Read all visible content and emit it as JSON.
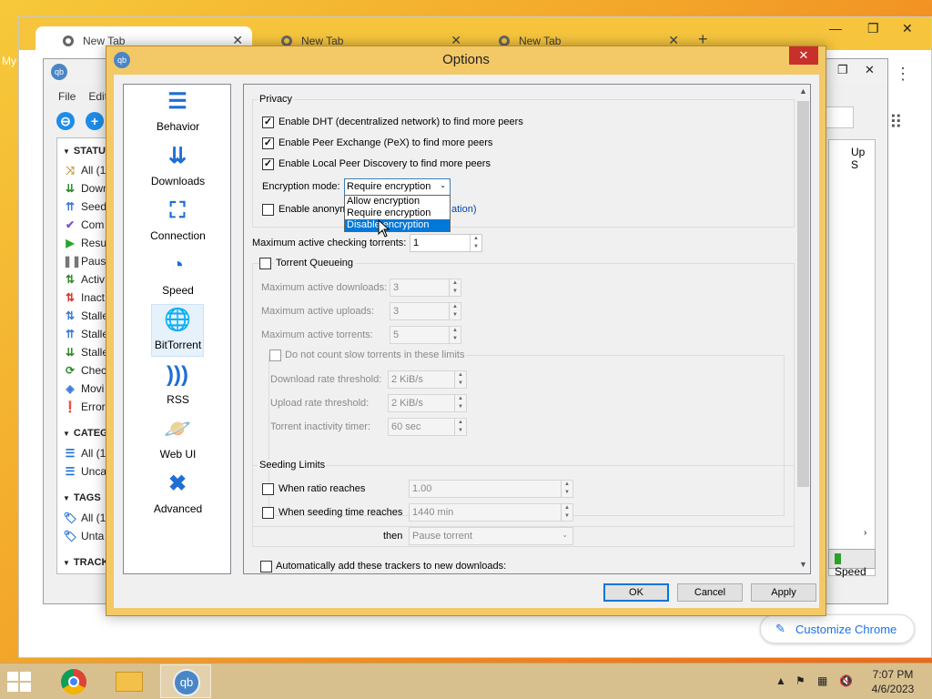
{
  "desktop": {
    "icon_label": "My"
  },
  "chrome": {
    "tabs": [
      {
        "title": "New Tab"
      },
      {
        "title": "New Tab"
      },
      {
        "title": "New Tab"
      }
    ],
    "customize_label": "Customize Chrome"
  },
  "qbt": {
    "menu": [
      "File",
      "Edit"
    ],
    "status_header": "STATUS",
    "status_items": [
      {
        "label": "All (1",
        "icon": "shuffle-icon",
        "color": "#c79a35"
      },
      {
        "label": "Down",
        "icon": "download-icon",
        "color": "#2e8b2e"
      },
      {
        "label": "Seed",
        "icon": "seed-icon",
        "color": "#3a7bd5"
      },
      {
        "label": "Com",
        "icon": "check-icon",
        "color": "#7b4fd0"
      },
      {
        "label": "Resu",
        "icon": "play-icon",
        "color": "#2aa52a"
      },
      {
        "label": "Paus",
        "icon": "pause-icon",
        "color": "#777777"
      },
      {
        "label": "Activ",
        "icon": "active-icon",
        "color": "#2e8b2e"
      },
      {
        "label": "Inact",
        "icon": "inactive-icon",
        "color": "#d9342b"
      },
      {
        "label": "Stalle",
        "icon": "stalled-icon",
        "color": "#3a7bd5"
      },
      {
        "label": "Stalle",
        "icon": "stalled-up-icon",
        "color": "#3a7bd5"
      },
      {
        "label": "Stalle",
        "icon": "stalled-down-icon",
        "color": "#2e8b2e"
      },
      {
        "label": "Chec",
        "icon": "refresh-icon",
        "color": "#2e8b2e"
      },
      {
        "label": "Movi",
        "icon": "moving-icon",
        "color": "#3a7bd5"
      },
      {
        "label": "Error",
        "icon": "error-icon",
        "color": "#d9342b"
      }
    ],
    "categories_header": "CATEG",
    "category_items": [
      {
        "label": "All (1",
        "icon": "list-icon"
      },
      {
        "label": "Unca",
        "icon": "list-icon"
      }
    ],
    "tags_header": "TAGS",
    "tag_items": [
      {
        "label": "All (1",
        "icon": "tag-icon"
      },
      {
        "label": "Unta",
        "icon": "tag-icon"
      }
    ],
    "trackers_header": "TRACK",
    "column_header": "Up S",
    "speed_button": "Speed"
  },
  "options": {
    "title": "Options",
    "nav": [
      {
        "label": "Behavior",
        "icon": "sliders-icon"
      },
      {
        "label": "Downloads",
        "icon": "chevrons-down-icon"
      },
      {
        "label": "Connection",
        "icon": "network-icon"
      },
      {
        "label": "Speed",
        "icon": "gauge-icon"
      },
      {
        "label": "BitTorrent",
        "icon": "globe-icon",
        "selected": true
      },
      {
        "label": "RSS",
        "icon": "rss-icon"
      },
      {
        "label": "Web UI",
        "icon": "planet-icon"
      },
      {
        "label": "Advanced",
        "icon": "tools-icon"
      }
    ],
    "privacy": {
      "title": "Privacy",
      "dht": {
        "label": "Enable DHT (decentralized network) to find more peers",
        "checked": true
      },
      "pex": {
        "label": "Enable Peer Exchange (PeX) to find more peers",
        "checked": true
      },
      "lpd": {
        "label": "Enable Local Peer Discovery to find more peers",
        "checked": true
      },
      "encryption_label": "Encryption mode:",
      "encryption_value": "Require encryption",
      "encryption_options": [
        "Allow encryption",
        "Require encryption",
        "Disable encryption"
      ],
      "highlighted_option": "Disable encryption",
      "anonymous_prefix": "Enable anonym",
      "anonymous_link_tail": "ation)"
    },
    "max_checking_label": "Maximum active checking torrents:",
    "max_checking_value": "1",
    "queueing": {
      "title": "Torrent Queueing",
      "checked": false,
      "max_downloads_label": "Maximum active downloads:",
      "max_downloads_value": "3",
      "max_uploads_label": "Maximum active uploads:",
      "max_uploads_value": "3",
      "max_torrents_label": "Maximum active torrents:",
      "max_torrents_value": "5",
      "slow_title": "Do not count slow torrents in these limits",
      "dl_threshold_label": "Download rate threshold:",
      "dl_threshold_value": "2 KiB/s",
      "ul_threshold_label": "Upload rate threshold:",
      "ul_threshold_value": "2 KiB/s",
      "inactivity_label": "Torrent inactivity timer:",
      "inactivity_value": "60 sec"
    },
    "seeding": {
      "title": "Seeding Limits",
      "ratio_label": "When ratio reaches",
      "ratio_value": "1.00",
      "time_label": "When seeding time reaches",
      "time_value": "1440 min",
      "then_label": "then",
      "action_value": "Pause torrent"
    },
    "trackers_label": "Automatically add these trackers to new downloads:",
    "buttons": {
      "ok": "OK",
      "cancel": "Cancel",
      "apply": "Apply"
    }
  },
  "taskbar": {
    "qb_label": "qb",
    "time": "7:07 PM",
    "date": "4/6/2023"
  }
}
